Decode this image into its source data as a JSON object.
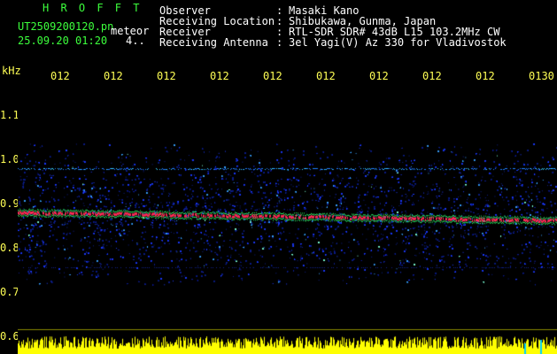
{
  "header": {
    "app_name": "H R O F F T",
    "file_name": "UT2509200120.pn",
    "event_label": "meteor",
    "datetime": "25.09.20 01:20",
    "count": "4..",
    "fields": [
      {
        "label": "Observer",
        "value": "Masaki Kano"
      },
      {
        "label": "Receiving Location",
        "value": "Shibukawa, Gunma, Japan"
      },
      {
        "label": "Receiver",
        "value": "RTL-SDR SDR# 43dB L15 103.2MHz CW"
      },
      {
        "label": "Receiving Antenna",
        "value": "3el Yagi(V) Az 330 for Vladivostok"
      }
    ]
  },
  "plot": {
    "y_unit": "kHz",
    "y_ticks": [
      "1.1",
      "1.0",
      "0.9",
      "0.8",
      "0.7",
      "0.6"
    ],
    "time_ticks": [
      "012",
      "012",
      "012",
      "012",
      "012",
      "012",
      "012",
      "012",
      "012",
      "0130"
    ],
    "colors": {
      "axis_text": "#ffff55",
      "label_text": "#ffffff",
      "title": "#3cff3c",
      "signal_line": "#ff2a55",
      "noise": "#1f3cff",
      "amplitude": "#ffff00"
    }
  }
}
